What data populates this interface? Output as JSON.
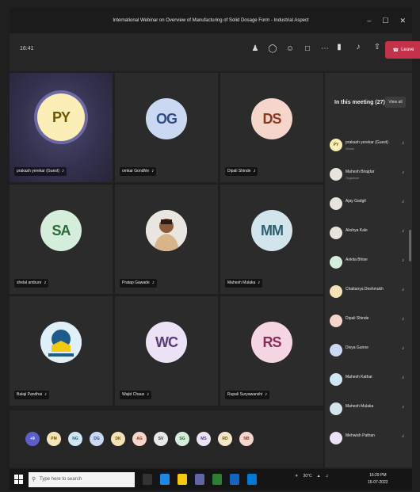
{
  "window": {
    "title": "International Webinar on Overview of Manufacturing of Solid Dosage Form - Industrial Aspect",
    "controls": [
      "–",
      "☐",
      "✕"
    ]
  },
  "toolbar": {
    "timer": "16:41",
    "leave_label": "Leave"
  },
  "grid": {
    "tiles": [
      {
        "initials": "PY",
        "name": "prakash yerekar (Guest)",
        "bg": "#fbeeb7",
        "fg": "#6b5600",
        "active": true
      },
      {
        "initials": "OG",
        "name": "omkar Gondhle",
        "bg": "#cbd8f2",
        "fg": "#2f4c84"
      },
      {
        "initials": "DS",
        "name": "Dipali Shinde",
        "bg": "#f6d5cb",
        "fg": "#8b3a22"
      },
      {
        "initials": "SA",
        "name": "shelal ambure",
        "bg": "#d5eedc",
        "fg": "#2a6a3a"
      },
      {
        "initials": "",
        "name": "Pratap Gawade",
        "bg": "#e7e3dd",
        "fg": "#333",
        "photo": true
      },
      {
        "initials": "MM",
        "name": "Mahesh Mulaka",
        "bg": "#d2e5ec",
        "fg": "#2f5f6e"
      },
      {
        "initials": "",
        "name": "Balaji Pandhai",
        "bg": "#dff0fb",
        "fg": "#1d5b8b",
        "logo": true
      },
      {
        "initials": "WC",
        "name": "Wajid Chaus",
        "bg": "#ece2f5",
        "fg": "#5a3a7d"
      },
      {
        "initials": "RS",
        "name": "Rupali Suryawanshi",
        "bg": "#f7d6e3",
        "fg": "#8b2c55"
      }
    ]
  },
  "strip": {
    "items": [
      {
        "initials": "+9",
        "bg": "#5b5fc7",
        "fg": "#fff"
      },
      {
        "initials": "PM",
        "bg": "#f5e4b8",
        "fg": "#6b5600"
      },
      {
        "initials": "NG",
        "bg": "#cfe7f3",
        "fg": "#2f5f6e"
      },
      {
        "initials": "DG",
        "bg": "#cbd8f2",
        "fg": "#2f4c84"
      },
      {
        "initials": "DK",
        "bg": "#f7e1b6",
        "fg": "#7a4e00"
      },
      {
        "initials": "AG",
        "bg": "#f6d5cb",
        "fg": "#8b3a22"
      },
      {
        "initials": "SV",
        "bg": "#e9e9e9",
        "fg": "#333"
      },
      {
        "initials": "SG",
        "bg": "#d5eedc",
        "fg": "#2a6a3a"
      },
      {
        "initials": "MS",
        "bg": "#ece2f5",
        "fg": "#5a3a7d"
      },
      {
        "initials": "RD",
        "bg": "#f4e6c8",
        "fg": "#6b5600"
      },
      {
        "initials": "NB",
        "bg": "#f6d5cb",
        "fg": "#8b3a22"
      }
    ]
  },
  "panel": {
    "title": "In this meeting",
    "count": "(27)",
    "view_all": "View all",
    "participants": [
      {
        "initials": "PY",
        "name": "prakash yerekar (Guest)",
        "sub": "Guest",
        "bg": "#fbeeb7",
        "fg": "#6b5600"
      },
      {
        "initials": "",
        "name": "Mahesh Birajdar",
        "sub": "Organizer",
        "bg": "#e7e3dd",
        "fg": "#333"
      },
      {
        "initials": "",
        "name": "Ajay Gadgil",
        "sub": "",
        "bg": "#e7e3dd",
        "fg": "#333"
      },
      {
        "initials": "",
        "name": "Akshya Kale",
        "sub": "",
        "bg": "#e7e3dd",
        "fg": "#333"
      },
      {
        "initials": "",
        "name": "Ankita Bhise",
        "sub": "",
        "bg": "#d5eedc",
        "fg": "#2a6a3a"
      },
      {
        "initials": "",
        "name": "Chaitanya Deshmukh",
        "sub": "",
        "bg": "#f7e1b6",
        "fg": "#7a4e00"
      },
      {
        "initials": "",
        "name": "Dipali Shinde",
        "sub": "",
        "bg": "#f6d5cb",
        "fg": "#8b3a22"
      },
      {
        "initials": "",
        "name": "Divya Gunne",
        "sub": "",
        "bg": "#cbd8f2",
        "fg": "#2f4c84"
      },
      {
        "initials": "",
        "name": "Mahesh Kathar",
        "sub": "",
        "bg": "#cfe7f3",
        "fg": "#2f5f6e"
      },
      {
        "initials": "",
        "name": "Mahesh Mulaka",
        "sub": "",
        "bg": "#d2e5ec",
        "fg": "#2f5f6e"
      },
      {
        "initials": "",
        "name": "Mehwish Pathan",
        "sub": "",
        "bg": "#ece2f5",
        "fg": "#5a3a7d"
      }
    ]
  },
  "taskbar": {
    "search_placeholder": "Type here to search",
    "clock_time": "16:29 PM",
    "clock_date": "16-07-2022",
    "temp": "30°C"
  }
}
